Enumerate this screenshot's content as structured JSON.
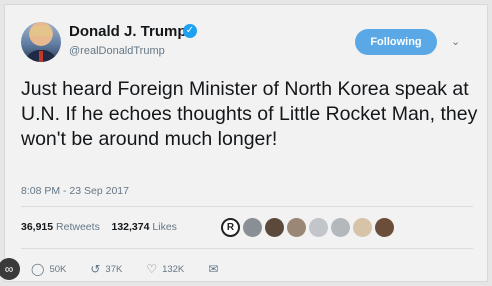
{
  "author": {
    "name": "Donald J. Trump",
    "handle": "@realDonaldTrump"
  },
  "follow_button": {
    "label": "Following"
  },
  "tweet": {
    "text": "Just heard Foreign Minister of North Korea speak at U.N. If he echoes thoughts of Little Rocket Man, they won't be around much longer!",
    "timestamp": "8:08 PM - 23 Sep 2017"
  },
  "stats": {
    "retweets_count": "36,915",
    "retweets_label": "Retweets",
    "likes_count": "132,374",
    "likes_label": "Likes"
  },
  "likers": [
    {
      "color": "#ffffff",
      "letter": "R"
    },
    {
      "color": "#8a8f95"
    },
    {
      "color": "#5b4a3c"
    },
    {
      "color": "#9a8776"
    },
    {
      "color": "#c2c6ca"
    },
    {
      "color": "#b3b8bc"
    },
    {
      "color": "#d7c4a8"
    },
    {
      "color": "#6b4d3a"
    }
  ],
  "actions": {
    "replies": "50K",
    "retweets": "37K",
    "likes": "132K"
  },
  "colors": {
    "accent": "#1da1f2",
    "follow_button": "#5aa9e6",
    "muted_text": "#657786"
  }
}
